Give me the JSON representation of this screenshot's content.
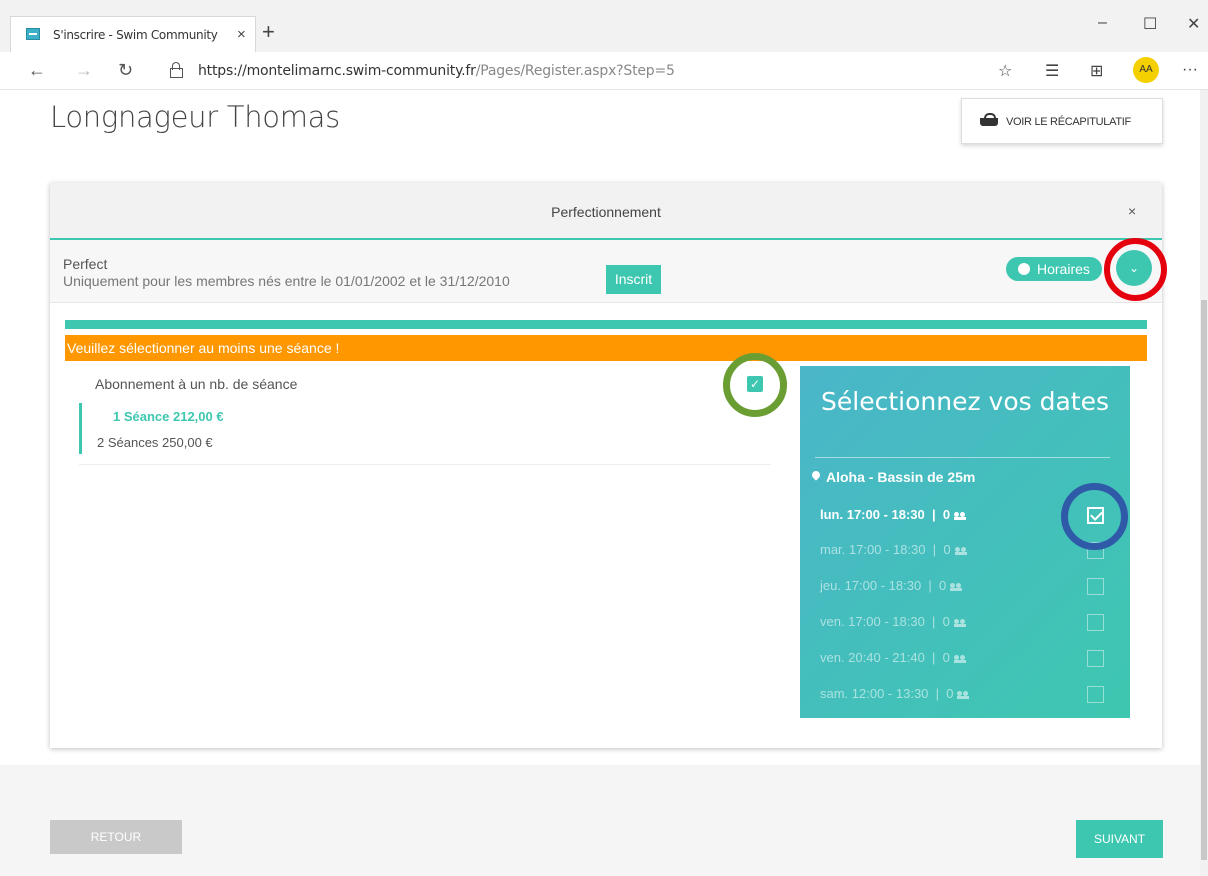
{
  "browser": {
    "tab_title": "S'inscrire - Swim Community",
    "tab_close": "×",
    "new_tab": "+",
    "url_main": "https://montelimarnc.swim-community.fr",
    "url_path": "/Pages/Register.aspx?Step=5",
    "minimize": "–",
    "maximize": "☐",
    "close": "✕",
    "more": "···",
    "profile_initials": "AA"
  },
  "page": {
    "title": "Longnageur Thomas",
    "recap_label": "VOIR LE RÉCAPITULATIF",
    "back_label": "RETOUR",
    "next_label": "SUIVANT"
  },
  "card": {
    "title": "Perfectionnement",
    "close": "×",
    "course_name": "Perfect",
    "course_desc": "Uniquement pour les membres nés entre le 01/01/2002 et le 31/12/2010",
    "inscrit_label": "Inscrit",
    "horaires_label": "Horaires",
    "chevron": "⌄",
    "warning": "Veuillez sélectionner au moins une séance !",
    "subscription_title": "Abonnement à un nb. de séance",
    "options": [
      {
        "label": "1 Séance 212,00 €",
        "selected": true
      },
      {
        "label": "2 Séances 250,00 €",
        "selected": false
      }
    ],
    "subscription_checked": true
  },
  "dates": {
    "title": "Sélectionnez vos dates",
    "location": "Aloha - Bassin de 25m",
    "slots": [
      {
        "label": "lun. 17:00 - 18:30",
        "count": "0",
        "checked": true
      },
      {
        "label": "mar. 17:00 - 18:30",
        "count": "0",
        "checked": false
      },
      {
        "label": "jeu. 17:00 - 18:30",
        "count": "0",
        "checked": false
      },
      {
        "label": "ven. 17:00 - 18:30",
        "count": "0",
        "checked": false
      },
      {
        "label": "ven. 20:40 - 21:40",
        "count": "0",
        "checked": false
      },
      {
        "label": "sam. 12:00 - 13:30",
        "count": "0",
        "checked": false
      }
    ]
  },
  "colors": {
    "accent": "#3ec7b0",
    "warning": "#ff9800",
    "annotation_red": "#e5000e",
    "annotation_green": "#6a9e33",
    "annotation_blue": "#2f5aa8"
  }
}
